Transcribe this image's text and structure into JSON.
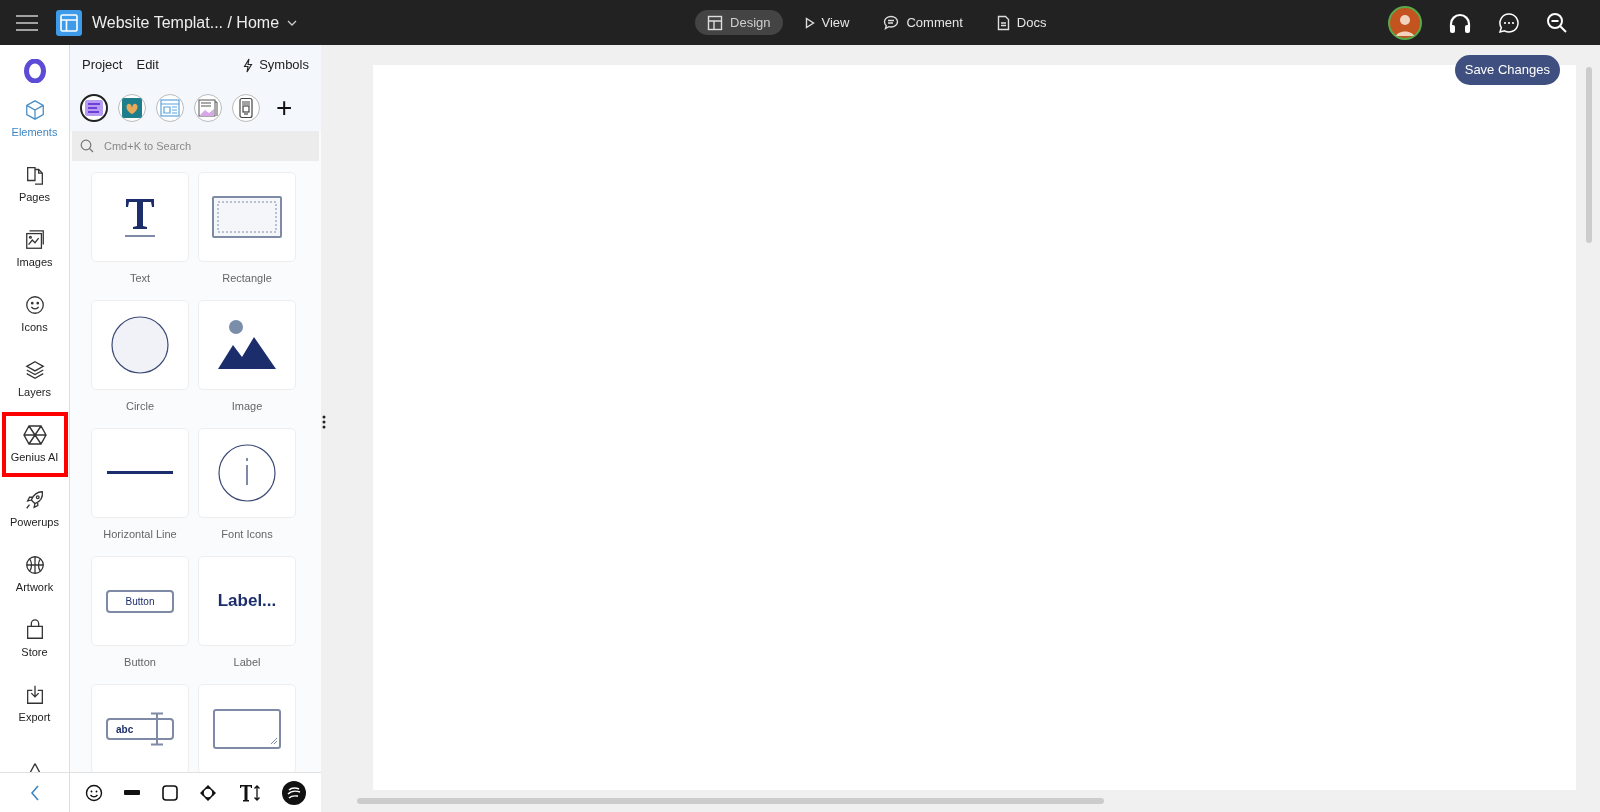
{
  "topbar": {
    "title": "Website Templat... / Home",
    "modes": [
      {
        "label": "Design",
        "kind": "design",
        "selected": true
      },
      {
        "label": "View",
        "kind": "view",
        "selected": false
      },
      {
        "label": "Comment",
        "kind": "comment",
        "selected": false
      },
      {
        "label": "Docs",
        "kind": "docs",
        "selected": false
      }
    ]
  },
  "rail": [
    {
      "label": "Elements",
      "kind": "elements",
      "selected": true,
      "highlighted": false
    },
    {
      "label": "Pages",
      "kind": "pages",
      "selected": false,
      "highlighted": false
    },
    {
      "label": "Images",
      "kind": "images",
      "selected": false,
      "highlighted": false
    },
    {
      "label": "Icons",
      "kind": "icons",
      "selected": false,
      "highlighted": false
    },
    {
      "label": "Layers",
      "kind": "layers",
      "selected": false,
      "highlighted": false
    },
    {
      "label": "Genius AI",
      "kind": "genius",
      "selected": false,
      "highlighted": true
    },
    {
      "label": "Powerups",
      "kind": "powerups",
      "selected": false,
      "highlighted": false
    },
    {
      "label": "Artwork",
      "kind": "artwork",
      "selected": false,
      "highlighted": false
    },
    {
      "label": "Store",
      "kind": "store",
      "selected": false,
      "highlighted": false
    },
    {
      "label": "Export",
      "kind": "export",
      "selected": false,
      "highlighted": false
    },
    {
      "kind": "compass",
      "selected": false,
      "highlighted": false
    }
  ],
  "panel": {
    "menus": [
      "Project",
      "Edit"
    ],
    "symbols": "Symbols",
    "libraries": [
      {
        "kind": "purple",
        "selected": true
      },
      {
        "kind": "teal",
        "selected": false
      },
      {
        "kind": "blue",
        "selected": false
      },
      {
        "kind": "pink",
        "selected": false
      },
      {
        "kind": "phone",
        "selected": false
      }
    ],
    "add": "+",
    "search": {
      "placeholder": "Cmd+K to Search"
    },
    "elements": [
      {
        "kind": "text",
        "label": "Text"
      },
      {
        "kind": "rectangle",
        "label": "Rectangle"
      },
      {
        "kind": "circle",
        "label": "Circle"
      },
      {
        "kind": "image",
        "label": "Image"
      },
      {
        "kind": "line",
        "label": "Horizontal Line"
      },
      {
        "kind": "fonticon",
        "label": "Font Icons"
      },
      {
        "kind": "button",
        "label": "Button",
        "preview_text": "Button"
      },
      {
        "kind": "label",
        "label": "Label",
        "preview_text": "Label..."
      },
      {
        "kind": "input",
        "preview_text": "abc"
      },
      {
        "kind": "textarea"
      }
    ]
  },
  "canvas": {
    "save": "Save Changes"
  }
}
